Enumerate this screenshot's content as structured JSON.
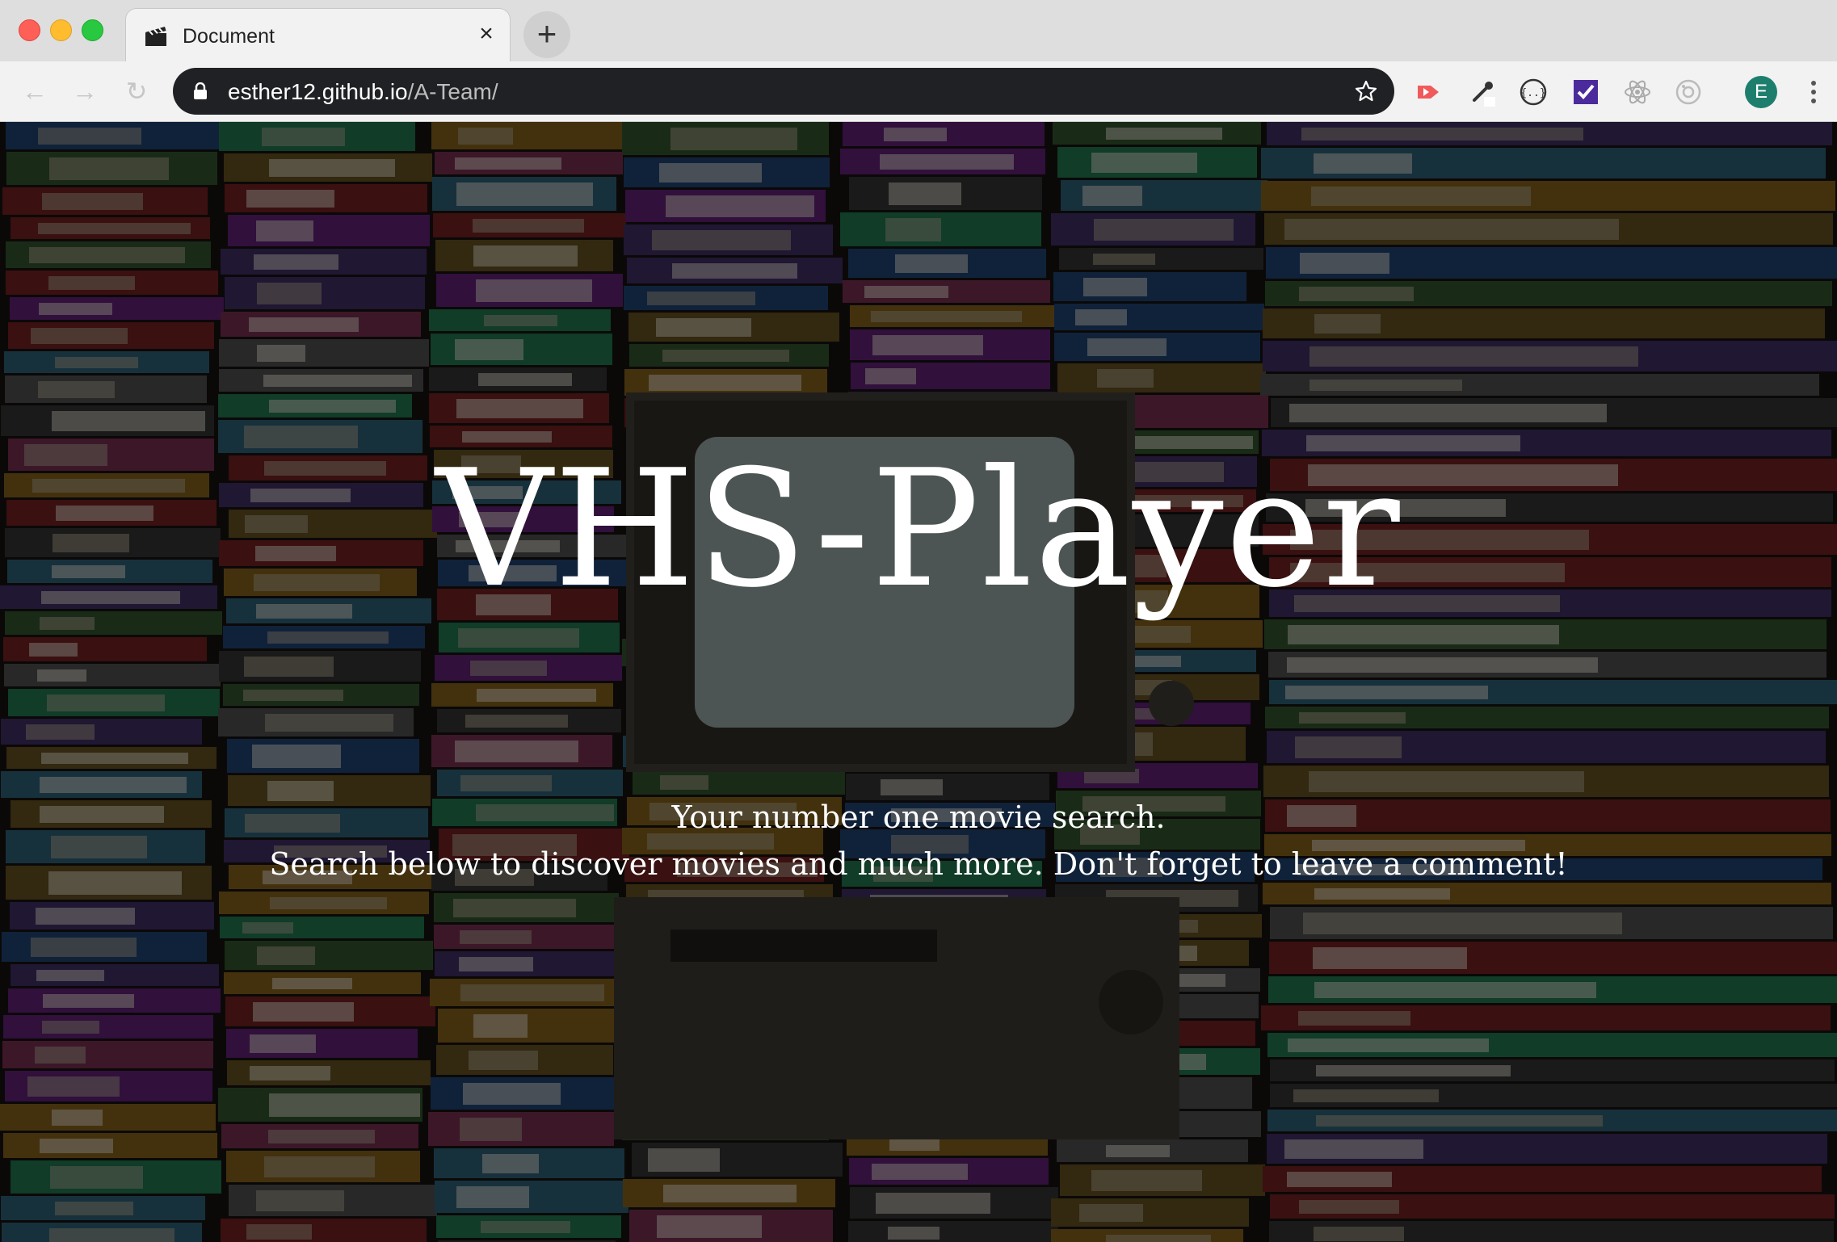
{
  "browser": {
    "tab_title": "Document",
    "url_host": "esther12.github.io",
    "url_path": "/A-Team/",
    "profile_initial": "E",
    "extensions": [
      "screencast-icon",
      "eyedropper-icon",
      "json-viewer-icon",
      "checkbox-extension-icon",
      "react-devtools-icon",
      "camera-extension-icon"
    ]
  },
  "hero": {
    "title": "VHS-Player",
    "tagline_line1": "Your number one movie search.",
    "tagline_line2": "Search below to discover movies and much more. Don't forget to leave a comment!"
  },
  "colors": {
    "omnibox": "#202124",
    "avatar": "#1e7e6e",
    "overlay": "rgba(0,0,0,0.45)"
  }
}
